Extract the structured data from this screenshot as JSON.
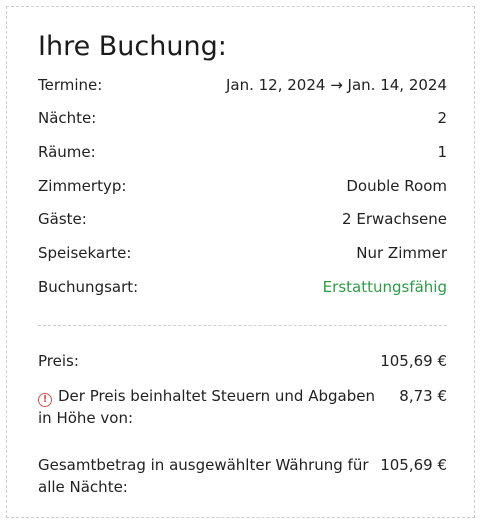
{
  "booking": {
    "title": "Ihre Buchung:",
    "rows": [
      {
        "label": "Termine:",
        "value": "Jan. 12, 2024 → Jan. 14, 2024"
      },
      {
        "label": "Nächte:",
        "value": "2"
      },
      {
        "label": "Räume:",
        "value": "1"
      },
      {
        "label": "Zimmertyp:",
        "value": "Double Room"
      },
      {
        "label": "Gäste:",
        "value": "2 Erwachsene"
      },
      {
        "label": "Speisekarte:",
        "value": "Nur Zimmer"
      },
      {
        "label": "Buchungsart:",
        "value": "Erstattungsfähig"
      }
    ],
    "refundable_color": "#2e9d47"
  },
  "pricing": {
    "price_label": "Preis:",
    "price_value": "105,69 €",
    "tax_icon_name": "alert-circle-icon",
    "tax_icon_glyph": "!",
    "tax_label": "Der Preis beinhaltet Steuern und Abgaben in Höhe von:",
    "tax_value": "8,73 €",
    "total_label": "Gesamtbetrag in ausgewählter Währung für alle Nächte:",
    "total_value": "105,69 €",
    "warning_color": "#d9534f"
  }
}
